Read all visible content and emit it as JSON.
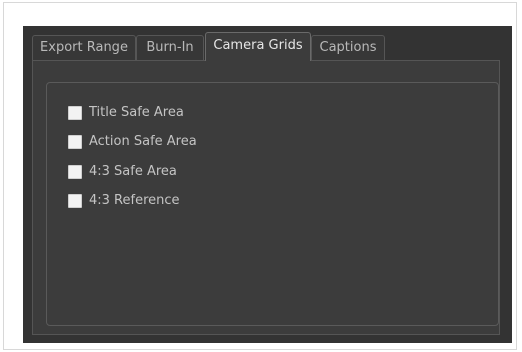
{
  "tabs": [
    {
      "label": "Export Range",
      "active": false
    },
    {
      "label": "Burn-In",
      "active": false
    },
    {
      "label": "Camera Grids",
      "active": true
    },
    {
      "label": "Captions",
      "active": false
    }
  ],
  "camera_grids": {
    "options": [
      {
        "label": "Title Safe Area",
        "checked": false
      },
      {
        "label": "Action Safe Area",
        "checked": false
      },
      {
        "label": "4:3 Safe Area",
        "checked": false
      },
      {
        "label": "4:3 Reference",
        "checked": false
      }
    ]
  },
  "colors": {
    "background": "#333333",
    "panel": "#3c3c3c",
    "checkbox": "#f2f2f2",
    "text": "#c4c4c4"
  }
}
